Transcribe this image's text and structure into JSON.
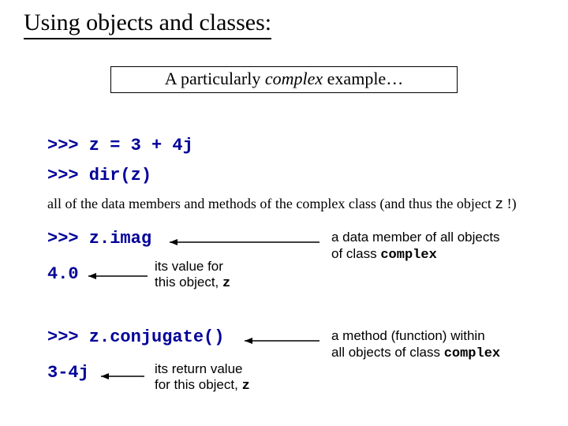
{
  "title": "Using objects and classes:",
  "subtitle_pre": "A particularly ",
  "subtitle_em": "complex",
  "subtitle_post": " example…",
  "code": {
    "line1": ">>> z = 3 + 4j",
    "line2": ">>> dir(z)",
    "line3": ">>> z.imag",
    "line4": "4.0",
    "line5": ">>> z.conjugate()",
    "line6": "3-4j"
  },
  "notes": {
    "allmembers_pre": "all of the data members and methods of the complex class (and thus the object ",
    "allmembers_z": "z",
    "allmembers_post": " !)",
    "value_line1": "its value for",
    "value_line2_pre": "this object, ",
    "value_line2_z": "z",
    "datamember_line1": "a data member of all objects",
    "datamember_line2_pre": "of class ",
    "datamember_line2_mono": "complex",
    "method_line1": "a method (function) within",
    "method_line2_pre": " all objects of class ",
    "method_line2_mono": "complex",
    "return_line1": "its return value",
    "return_line2_pre": "for this object, ",
    "return_line2_z": "z"
  }
}
